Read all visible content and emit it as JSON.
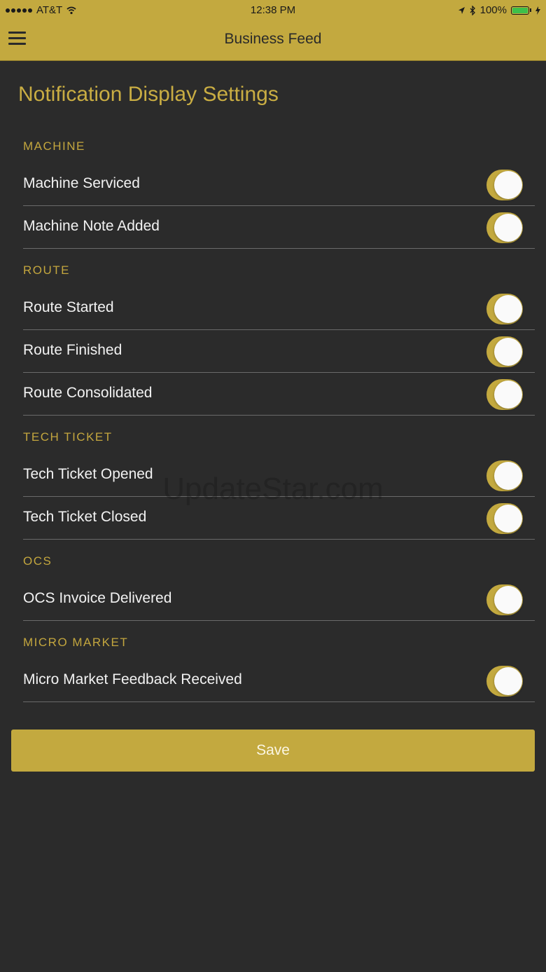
{
  "status_bar": {
    "carrier": "AT&T",
    "time": "12:38 PM",
    "battery": "100%"
  },
  "nav": {
    "title": "Business Feed"
  },
  "page_title": "Notification Display Settings",
  "sections": [
    {
      "header": "MACHINE",
      "items": [
        {
          "label": "Machine Serviced",
          "enabled": true
        },
        {
          "label": "Machine Note Added",
          "enabled": true
        }
      ]
    },
    {
      "header": "ROUTE",
      "items": [
        {
          "label": "Route Started",
          "enabled": true
        },
        {
          "label": "Route Finished",
          "enabled": true
        },
        {
          "label": "Route Consolidated",
          "enabled": true
        }
      ]
    },
    {
      "header": "TECH TICKET",
      "items": [
        {
          "label": "Tech Ticket Opened",
          "enabled": true
        },
        {
          "label": "Tech Ticket Closed",
          "enabled": true
        }
      ]
    },
    {
      "header": "OCS",
      "items": [
        {
          "label": "OCS Invoice Delivered",
          "enabled": true
        }
      ]
    },
    {
      "header": "MICRO MARKET",
      "items": [
        {
          "label": "Micro Market Feedback Received",
          "enabled": true
        }
      ]
    }
  ],
  "save_label": "Save",
  "watermark": "UpdateStar.com",
  "colors": {
    "accent": "#c3a93f",
    "background": "#2b2b2b",
    "battery_fill": "#3ec04a"
  }
}
